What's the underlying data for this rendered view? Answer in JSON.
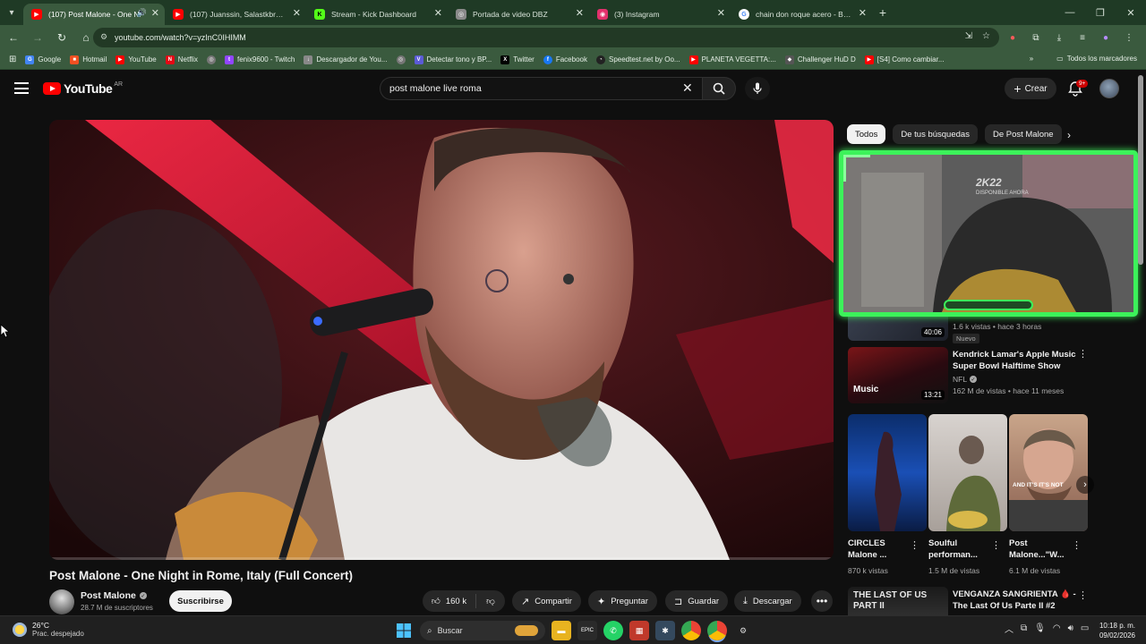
{
  "browser": {
    "tabs": [
      {
        "label": "(107) Post Malone - One Ni",
        "favicon": "youtube-icon",
        "color": "#ff0000",
        "active": true
      },
      {
        "label": "(107) Juanssin, Salastkbron - Tr",
        "favicon": "youtube-icon",
        "color": "#ff0000"
      },
      {
        "label": "Stream - Kick Dashboard",
        "favicon": "kick-icon",
        "color": "#53fc18"
      },
      {
        "label": "Portada de video DBZ",
        "favicon": "globe-icon",
        "color": "#8a8a8a"
      },
      {
        "label": "(3) Instagram",
        "favicon": "instagram-icon",
        "color": "#e1306c"
      },
      {
        "label": "chain don roque acero - Buscar",
        "favicon": "google-icon",
        "color": "#ffffff"
      }
    ],
    "url": "youtube.com/watch?v=yzInC0IHIMM",
    "bookmarks": [
      {
        "label": "Google",
        "color": "#4285f4"
      },
      {
        "label": "Hotmail",
        "color": "#f25022"
      },
      {
        "label": "YouTube",
        "color": "#ff0000"
      },
      {
        "label": "Netflix",
        "color": "#e50914"
      },
      {
        "label": "",
        "color": "#777777"
      },
      {
        "label": "fenix9600 - Twitch",
        "color": "#9146ff"
      },
      {
        "label": "Descargador de You...",
        "color": "#888888"
      },
      {
        "label": "",
        "color": "#777777"
      },
      {
        "label": "Detectar tono y BP...",
        "color": "#5b5bd6"
      },
      {
        "label": "Twitter",
        "color": "#000000"
      },
      {
        "label": "Facebook",
        "color": "#1877f2"
      },
      {
        "label": "Speedtest.net by Oo...",
        "color": "#222222"
      },
      {
        "label": "PLANETA VEGETTA:...",
        "color": "#ff0000"
      },
      {
        "label": "Challenger HuD D",
        "color": "#555555"
      },
      {
        "label": "[S4] Como cambiar...",
        "color": "#ff0000"
      }
    ],
    "all_bookmarks": "Todos los marcadores"
  },
  "youtube": {
    "logo_text": "YouTube",
    "country_code": "AR",
    "search_query": "post malone live roma",
    "create_label": "Crear",
    "notifications_badge": "9+",
    "video": {
      "title": "Post Malone - One Night in Rome, Italy (Full Concert)",
      "channel": "Post Malone",
      "subscribers": "28.7 M de suscriptores",
      "subscribe_label": "Suscribirse",
      "likes": "160 k",
      "share_label": "Compartir",
      "ask_label": "Preguntar",
      "save_label": "Guardar",
      "download_label": "Descargar",
      "progress": 0.0
    },
    "chips": [
      "Todos",
      "De tus búsquedas",
      "De Post Malone"
    ],
    "webcam": {
      "line1": "2K22",
      "line2": "DISPONIBLE AHORA"
    },
    "sidebar": [
      {
        "duration": "40:06",
        "meta": "1.6 k vistas • hace 3 horas",
        "badge": "Nuevo"
      },
      {
        "title": "Kendrick Lamar's Apple Music Super Bowl Halftime Show",
        "channel": "NFL",
        "duration": "13:21",
        "meta": "162 M de vistas • hace 11 meses",
        "thumb_text": "Music"
      },
      {
        "title": "VENGANZA SANGRIENTA 🩸 - The Last Of Us Parte II #2",
        "thumb_text": "THE LAST OF US PART II"
      }
    ],
    "shorts": [
      {
        "title": "CIRCLES Malone ...",
        "views": "870 k vistas"
      },
      {
        "title": "Soulful performan...",
        "views": "1.5 M de vistas"
      },
      {
        "title": "Post Malone...\"W...",
        "views": "6.1 M de vistas",
        "overlay": "AND IT'S IT'S NOT"
      }
    ]
  },
  "taskbar": {
    "temp": "26°C",
    "weather": "Prac. despejado",
    "search_label": "Buscar",
    "time": "10:18 p. m.",
    "date": "09/02/2026"
  },
  "colors": {
    "accent_green": "#3cf25a",
    "chrome_frame": "#1f3a25",
    "youtube_red": "#ff0000"
  }
}
